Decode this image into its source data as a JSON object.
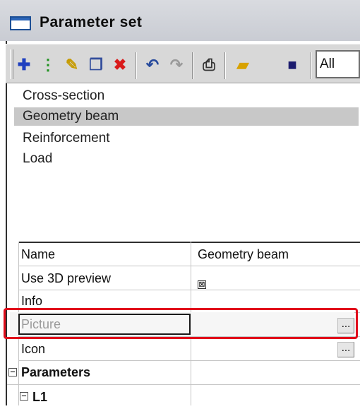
{
  "window": {
    "title": "Parameter set"
  },
  "toolbar": {
    "buttons": [
      {
        "name": "new-icon",
        "glyph": "✚",
        "color": "#1e3fbf"
      },
      {
        "name": "tree-icon",
        "glyph": "⋮",
        "color": "#239323"
      },
      {
        "name": "edit-pencil-icon",
        "glyph": "✎",
        "color": "#c69b00"
      },
      {
        "name": "copy-icon",
        "glyph": "❐",
        "color": "#334e9c"
      },
      {
        "name": "delete-icon",
        "glyph": "✖",
        "color": "#d91a1a"
      },
      {
        "name": "undo-icon",
        "glyph": "↶",
        "color": "#274a9c"
      },
      {
        "name": "redo-icon",
        "glyph": "↷",
        "color": "#9a9a9a"
      },
      {
        "name": "print-icon",
        "glyph": "⎙",
        "color": "#333333"
      },
      {
        "name": "open-folder-icon",
        "glyph": "▰",
        "color": "#d8a200"
      },
      {
        "name": "save-icon",
        "glyph": "■",
        "color": "#1b1b6e"
      }
    ],
    "filter_value": "All"
  },
  "list": {
    "items": [
      "Cross-section",
      "Geometry beam",
      "Reinforcement",
      "Load"
    ],
    "selected_index": 1
  },
  "properties": {
    "name_label": "Name",
    "name_value": "Geometry beam",
    "use3d_label": "Use 3D preview",
    "use3d_checked": true,
    "info_label": "Info",
    "picture_label": "Picture",
    "icon_label": "Icon",
    "ellipsis": "...",
    "parameters_label": "Parameters",
    "l1_label": "L1",
    "expand_minus": "⊟"
  },
  "colors": {
    "highlight_border": "#e10d1b",
    "selection": "#c8c8c8"
  }
}
